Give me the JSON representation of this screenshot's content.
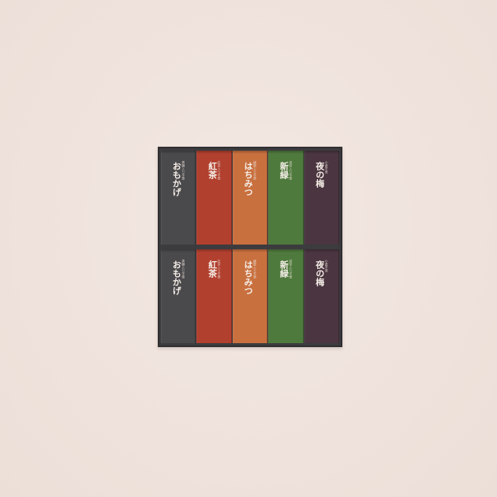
{
  "colors": {
    "background": "#f0e4de",
    "box": "#3c3b3e"
  },
  "packages": [
    {
      "name": "おもかげ",
      "sub": "黒糖入り羊羹",
      "color": "#4a494c"
    },
    {
      "name": "紅茶",
      "sub": "紅茶入り羊羹",
      "color": "#b2402f"
    },
    {
      "name": "はちみつ",
      "sub": "蜂蜜入り羊羹",
      "color": "#c9703f"
    },
    {
      "name": "新緑",
      "sub": "抹茶入り羊羹",
      "color": "#4f7a3d"
    },
    {
      "name": "夜の梅",
      "sub": "小倉羊羹",
      "color": "#4a3540"
    }
  ]
}
